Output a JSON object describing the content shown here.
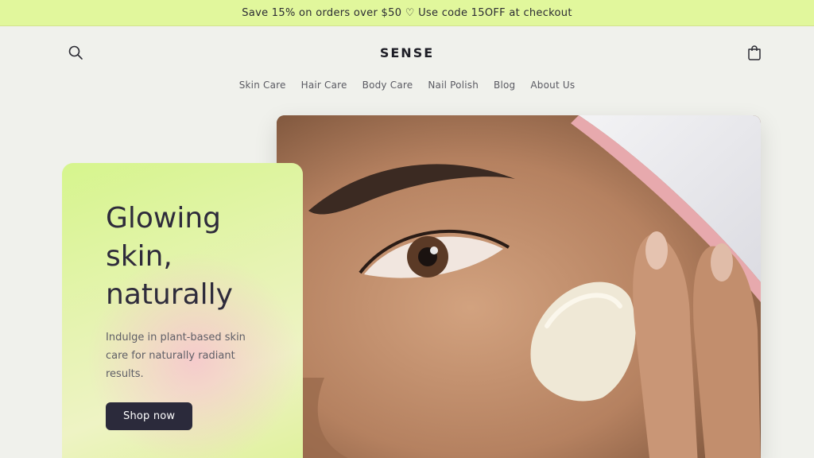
{
  "announcement": {
    "text": "Save 15% on orders over $50 ♡ Use code 15OFF at checkout"
  },
  "header": {
    "logo": "SENSE",
    "search_icon": "search-icon",
    "cart_icon": "cart-icon"
  },
  "nav": {
    "items": [
      {
        "label": "Skin Care"
      },
      {
        "label": "Hair Care"
      },
      {
        "label": "Body Care"
      },
      {
        "label": "Nail Polish"
      },
      {
        "label": "Blog"
      },
      {
        "label": "About Us"
      }
    ]
  },
  "hero": {
    "title_line1": "Glowing",
    "title_line2": "skin,",
    "title_line3": "naturally",
    "subtitle": "Indulge in plant-based skin care for naturally radiant results.",
    "cta_label": "Shop now"
  },
  "colors": {
    "announcement_bg": "#e1f79c",
    "page_bg": "#f0f1ec",
    "cta_bg": "#2b2a3b",
    "card_gradient_start": "#d6f58d",
    "card_gradient_pink": "#f7c4ce"
  }
}
